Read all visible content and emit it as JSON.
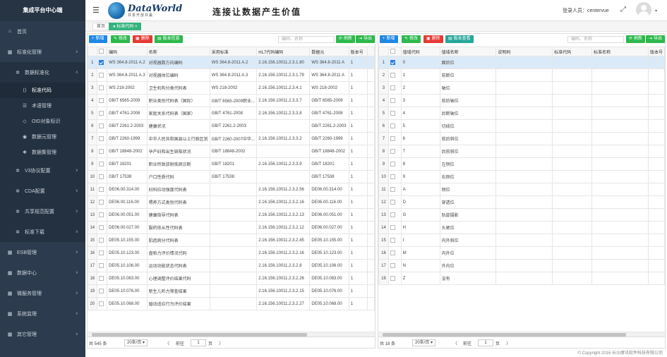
{
  "sidebar": {
    "title": "集成平台中心端",
    "items": [
      {
        "label": "首页",
        "icon": "home-icon",
        "glyph": "⌂",
        "level": 1
      },
      {
        "label": "标准化管理",
        "icon": "grid-icon",
        "glyph": "▦",
        "level": 1,
        "chev": "∧"
      },
      {
        "label": "数据标准化",
        "icon": "gear-icon",
        "glyph": "✲",
        "level": 2,
        "chev": "∧"
      },
      {
        "label": "标准代码",
        "icon": "code-icon",
        "glyph": "⟨⟩",
        "level": 3,
        "active": true
      },
      {
        "label": "术语管理",
        "icon": "list-icon",
        "glyph": "☰",
        "level": 3
      },
      {
        "label": "OID对象标识",
        "icon": "tag-icon",
        "glyph": "◇",
        "level": 3
      },
      {
        "label": "数据元管理",
        "icon": "database-icon",
        "glyph": "◉",
        "level": 3
      },
      {
        "label": "数据集管理",
        "icon": "dataset-icon",
        "glyph": "❖",
        "level": 3
      },
      {
        "label": "V3协议配置",
        "icon": "protocol-icon",
        "glyph": "✲",
        "level": 2,
        "chev": "∨"
      },
      {
        "label": "CDA配置",
        "icon": "cda-icon",
        "glyph": "✲",
        "level": 2,
        "chev": "∨"
      },
      {
        "label": "共享规范配置",
        "icon": "share-icon",
        "glyph": "✲",
        "level": 2,
        "chev": "∨"
      },
      {
        "label": "标准下载",
        "icon": "download-icon",
        "glyph": "✲",
        "level": 2,
        "chev": "∨"
      },
      {
        "label": "ESB管理",
        "icon": "esb-icon",
        "glyph": "▦",
        "level": 1,
        "chev": "∨"
      },
      {
        "label": "数据中心",
        "icon": "datacenter-icon",
        "glyph": "▦",
        "level": 1,
        "chev": "∨"
      },
      {
        "label": "微服务管理",
        "icon": "microservice-icon",
        "glyph": "▦",
        "level": 1,
        "chev": "∨"
      },
      {
        "label": "系统监理",
        "icon": "monitor-icon",
        "glyph": "▦",
        "level": 1,
        "chev": "∨"
      },
      {
        "label": "其它管理",
        "icon": "other-icon",
        "glyph": "▦",
        "level": 1,
        "chev": "∨"
      }
    ]
  },
  "header": {
    "logo_text": "DataWorld",
    "logo_sub": "共享开放共赢",
    "slogan": "连接让数据产生价值",
    "login_label": "登录人员：",
    "login_user": "centervue",
    "fullscreen": "⤢",
    "caret": "▾"
  },
  "tabs": [
    {
      "label": "首页"
    },
    {
      "label": "● 标准代码 ×"
    }
  ],
  "left": {
    "buttons": {
      "add": "新增",
      "edit": "修改",
      "del": "删除",
      "version": "版本信息",
      "refresh": "刷新",
      "export": "导出"
    },
    "search_placeholder": "编码、名称",
    "columns": [
      "",
      "",
      "编码",
      "名称",
      "采用标准",
      "HL7代码编码",
      "数据元",
      "版本号",
      ""
    ],
    "rows": [
      [
        "1",
        "WS 364.8-2011 A.2",
        "对视器数方向编码",
        "WS 364.8-2011 A.2",
        "2.16.156.10011.2.3.1.80",
        "WS 364.8-2011 A",
        "1"
      ],
      [
        "2",
        "WS 364.8-2011 A.3",
        "对视器体位编码",
        "WS 364.8-2011 A.3",
        "2.16.156.10011.2.3.1.79",
        "WS 364.8-2011 A",
        "1"
      ],
      [
        "3",
        "WS 218-2002",
        "卫生机构分类代码表",
        "WS 218-2002",
        "2.16.156.10011.2.3.4.1",
        "WS 218-2002",
        "1"
      ],
      [
        "4",
        "GB/T 6565-2009",
        "职业类别代码表（国际）",
        "GB/T 6565-2009职业...",
        "2.16.156.10011.2.3.3.7",
        "GB/T 6565-2009",
        "1"
      ],
      [
        "5",
        "GB/T 4761-2008",
        "家庭关系代码表（国家）",
        "GB/T 4761-2008",
        "2.16.156.10011.2.3.3.8",
        "GB/T 4761-2008",
        "1"
      ],
      [
        "6",
        "GB/T 2261.2-2003",
        "健康状况",
        "GB/T 2261.2-2003",
        "",
        "GB/T 2261.2-2003",
        "1"
      ],
      [
        "7",
        "GB/T 2260-1999",
        "中华人民共和国县以上行政区划",
        "GB/T 2260-2007中华...",
        "2.16.156.10011.2.3.3.2",
        "GB/T 2260-1999",
        "1"
      ],
      [
        "8",
        "GB/T 18848-2002",
        "孕产妇和出生缺陷状况",
        "GB/T 18848-2002",
        "",
        "GB/T 18848-2002",
        "1"
      ],
      [
        "9",
        "GB/T 18201",
        "职业所致放射疾病诊断",
        "GB/T 18201",
        "2.16.156.10011.2.3.3.9",
        "GB/T 18201",
        "1"
      ],
      [
        "10",
        "GB/T 17538",
        "户口性质代码",
        "GB/T 17538",
        "",
        "GB/T 17538",
        "1"
      ],
      [
        "11",
        "DE06.00.314.00",
        "妇科拉动强度代码表",
        "",
        "2.16.156.10011.2.3.2.56",
        "DE06.00.314.00",
        "1"
      ],
      [
        "12",
        "DE06.00.116.00",
        "喂养方式类别代码表",
        "",
        "2.16.156.10011.2.3.2.16",
        "DE06.00.116.00",
        "1"
      ],
      [
        "13",
        "DE06.00.051.00",
        "健康指导代码表",
        "",
        "2.16.156.10011.2.3.2.13",
        "DE06.00.051.00",
        "1"
      ],
      [
        "14",
        "DE06.00.027.00",
        "服药依从性代码表",
        "",
        "2.16.156.10011.2.3.2.12",
        "DE06.00.027.00",
        "1"
      ],
      [
        "15",
        "DE05.10.155.00",
        "肌癌病分代码表",
        "",
        "2.16.156.10011.2.3.2.45",
        "DE05.10.155.00",
        "1"
      ],
      [
        "16",
        "DE05.10.123.00",
        "盘帕力评价情况代码",
        "",
        "2.16.156.10011.2.3.2.16",
        "DE05.10.123.00",
        "1"
      ],
      [
        "17",
        "DE05.10.106.00",
        "运动功能状态代码表",
        "",
        "2.16.156.10011.2.3.2.8",
        "DE05.10.106.00",
        "1"
      ],
      [
        "18",
        "DE05.10.083.00",
        "心理调整评价结果代码",
        "",
        "2.16.156.10011.2.3.2.26",
        "DE05.10.083.00",
        "1"
      ],
      [
        "19",
        "DE05.10.076.00",
        "新生儿听力筛查结果",
        "",
        "2.16.156.10011.2.3.2.15",
        "DE05.10.076.00",
        "1"
      ],
      [
        "20",
        "DE05.10.068.00",
        "婚动适应行为评价结果",
        "",
        "2.16.156.10011.2.3.2.27",
        "DE05.10.068.00",
        "1"
      ]
    ],
    "pager": {
      "total": "共 545 条",
      "size": "20条/页 ▾",
      "prev": "〈",
      "goto": "前往",
      "page": "1",
      "unit": "页",
      "next": "〉"
    }
  },
  "right": {
    "buttons": {
      "add": "新增",
      "edit": "修改",
      "del": "删除",
      "version": "版本查看",
      "refresh": "刷新",
      "export": "导出"
    },
    "search_placeholder": "编码、名称",
    "columns": [
      "",
      "",
      "值域代码",
      "值域名称",
      "说明码",
      "标准代码",
      "标准名称",
      "版本号"
    ],
    "rows": [
      [
        "1",
        "0",
        "面后位"
      ],
      [
        "2",
        "1",
        "前断位"
      ],
      [
        "3",
        "2",
        "轴位"
      ],
      [
        "4",
        "3",
        "前后轴位"
      ],
      [
        "5",
        "4",
        "后断轴位"
      ],
      [
        "6",
        "5",
        "切线位"
      ],
      [
        "7",
        "6",
        "前后斜位"
      ],
      [
        "8",
        "7",
        "后前斜位"
      ],
      [
        "9",
        "8",
        "左侧位"
      ],
      [
        "10",
        "9",
        "右侧位"
      ],
      [
        "11",
        "A",
        "侧位"
      ],
      [
        "12",
        "D",
        "穿透位"
      ],
      [
        "13",
        "G",
        "轨旋摄影"
      ],
      [
        "14",
        "H",
        "头尾位"
      ],
      [
        "15",
        "I",
        "内外斜位"
      ],
      [
        "16",
        "M",
        "内外位"
      ],
      [
        "17",
        "N",
        "外内位"
      ],
      [
        "18",
        "Z",
        "没有"
      ]
    ],
    "pager": {
      "total": "共 18 条",
      "size": "20条/页 ▾",
      "prev": "〈",
      "goto": "前往",
      "page": "1",
      "unit": "页",
      "next": "〉"
    }
  },
  "footer": "© Copyright 2016 长沙摩讯软件科技有限公司"
}
